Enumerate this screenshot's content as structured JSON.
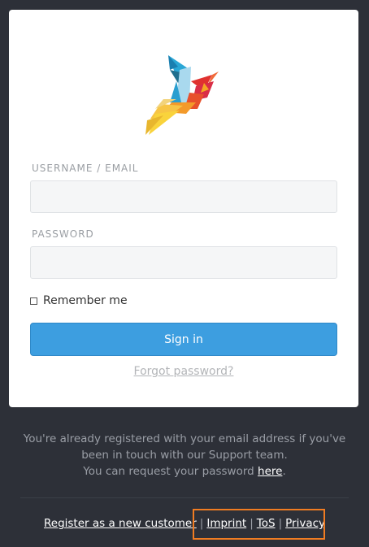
{
  "login": {
    "username_label": "USERNAME / EMAIL",
    "username_value": "",
    "password_label": "PASSWORD",
    "password_value": "",
    "remember_label": "Remember me",
    "signin_label": "Sign in",
    "forgot_label": "Forgot password?"
  },
  "info": {
    "line1": "You're already registered with your email address if you've",
    "line2": "been in touch with our Support team.",
    "line3_prefix": "You can request your password ",
    "line3_link": "here",
    "line3_suffix": "."
  },
  "footer": {
    "register": "Register as a new customer",
    "imprint": "Imprint",
    "tos": "ToS",
    "privacy": "Privacy",
    "separator": "|"
  },
  "colors": {
    "background": "#2d3038",
    "primary_button": "#3d9ee0",
    "highlight_box": "#f07c22"
  },
  "icons": {
    "logo": "origami-bird-logo",
    "checkbox": "checkbox-icon"
  }
}
